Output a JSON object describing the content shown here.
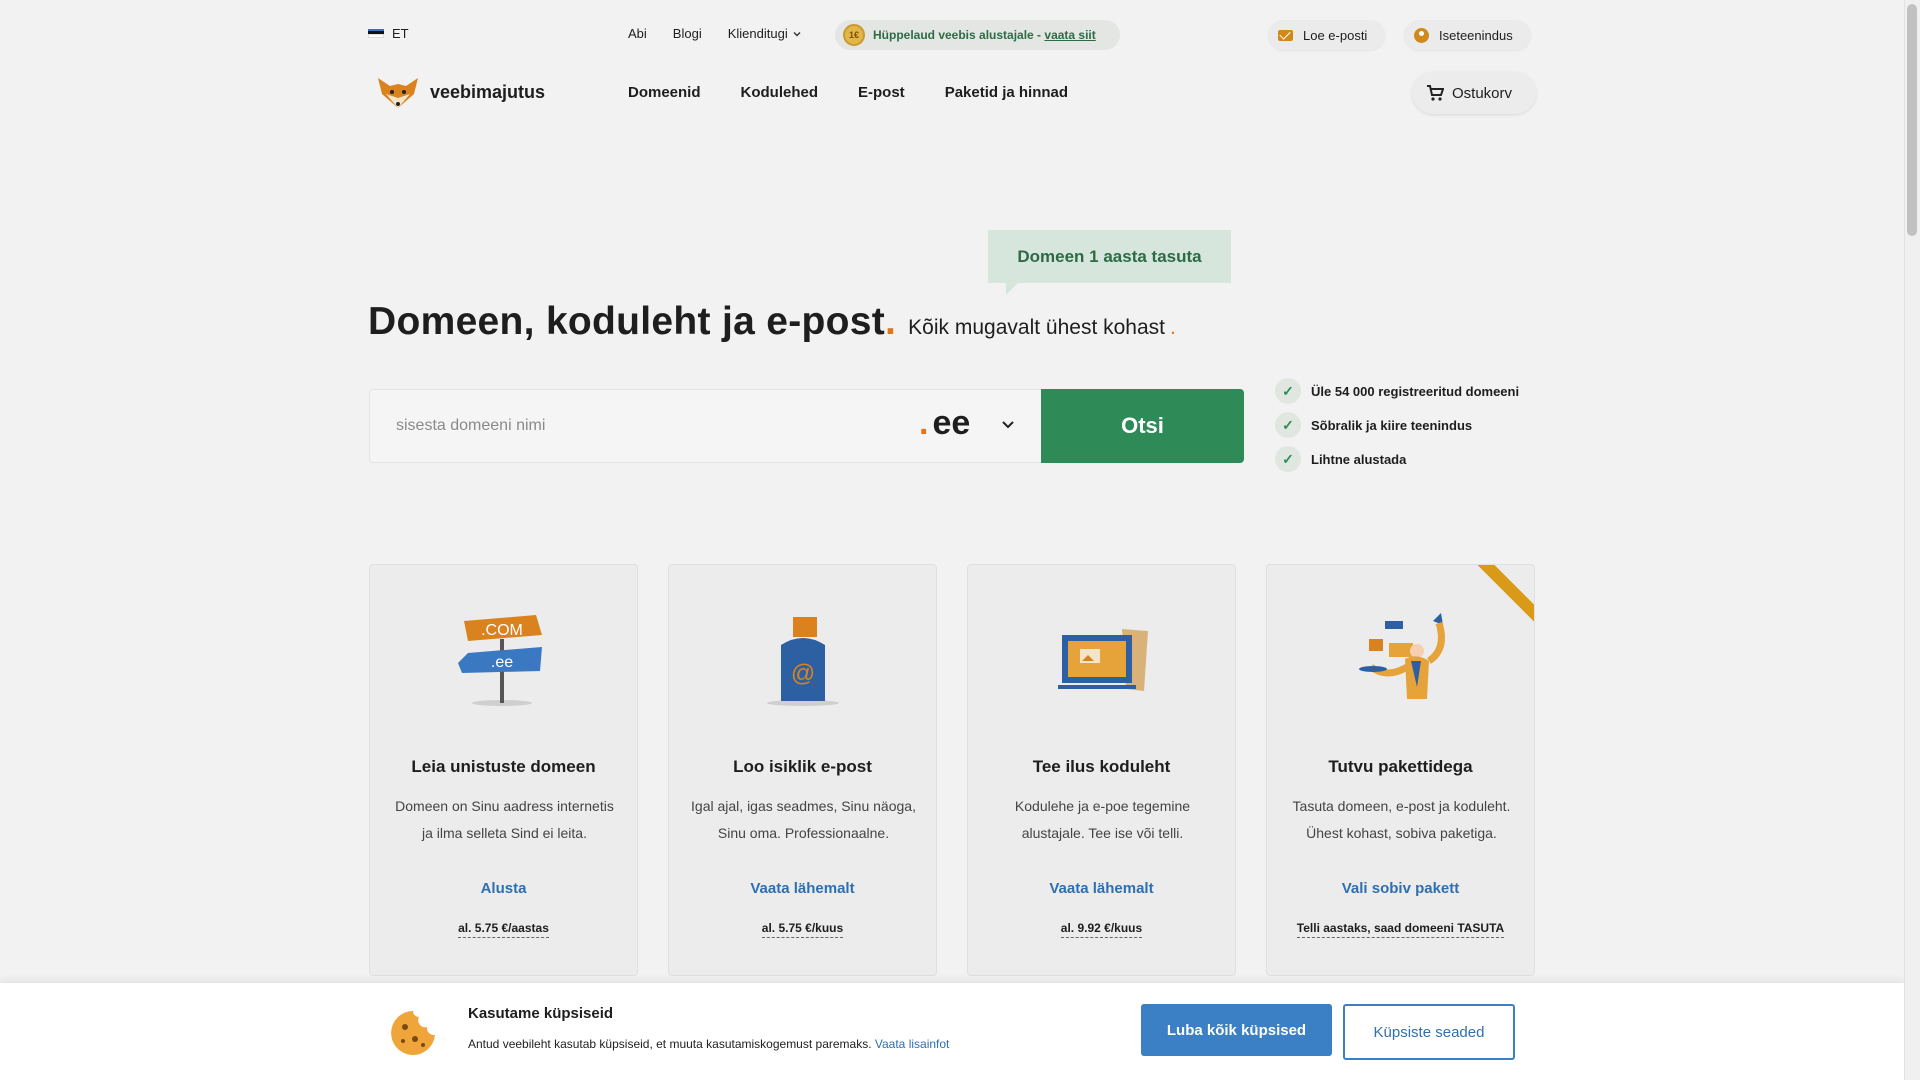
{
  "topbar": {
    "language": "ET",
    "links": [
      "Abi",
      "Blogi",
      "Klienditugi"
    ],
    "promo_text": "Hüppelaud veebis alustajale - ",
    "promo_link": "vaata siit",
    "read_mail": "Loe e-posti",
    "self_service": "Iseteenindus"
  },
  "nav": {
    "logo": "veebimajutus",
    "items": [
      "Domeenid",
      "Kodulehed",
      "E-post",
      "Paketid ja hinnad"
    ],
    "cart": "Ostukorv"
  },
  "hero": {
    "badge": "Domeen 1 aasta tasuta",
    "title": "Domeen, koduleht ja e-post",
    "subtitle": "Kõik mugavalt ühest kohast",
    "search_placeholder": "sisesta domeeni nimi",
    "tld": "ee",
    "search_button": "Otsi",
    "features": [
      "Üle 54 000 registreeritud domeeni",
      "Sõbralik ja kiire teenindus",
      "Lihtne alustada"
    ]
  },
  "cards": [
    {
      "title": "Leia unistuste domeen",
      "desc": "Domeen on Sinu aadress internetis ja ilma selleta Sind ei leita.",
      "link": "Alusta",
      "price": "al. 5.75 €/aastas",
      "sign_top": ".COM",
      "sign_bottom": ".ee"
    },
    {
      "title": "Loo isiklik e-post",
      "desc": "Igal ajal, igas seadmes, Sinu näoga, Sinu oma. Professionaalne.",
      "link": "Vaata lähemalt",
      "price": "al. 5.75 €/kuus"
    },
    {
      "title": "Tee ilus koduleht",
      "desc": "Kodulehe ja e-poe tegemine alustajale. Tee ise või telli.",
      "link": "Vaata lähemalt",
      "price": "al. 9.92 €/kuus"
    },
    {
      "title": "Tutvu pakettidega",
      "desc": "Tasuta domeen, e-post ja koduleht. Ühest kohast, sobiva paketiga.",
      "link": "Vali sobiv pakett",
      "price": "Telli aastaks, saad domeeni TASUTA"
    }
  ],
  "cookie": {
    "title": "Kasutame küpsiseid",
    "text": "Antud veebileht kasutab küpsiseid, et muuta kasutamiskogemust paremaks. ",
    "link": "Vaata lisainfot",
    "allow_all": "Luba kõik küpsised",
    "settings": "Küpsiste seaded"
  },
  "colors": {
    "accent_green": "#2e8b57",
    "accent_blue": "#3b7fc4",
    "accent_orange": "#e0761c"
  }
}
